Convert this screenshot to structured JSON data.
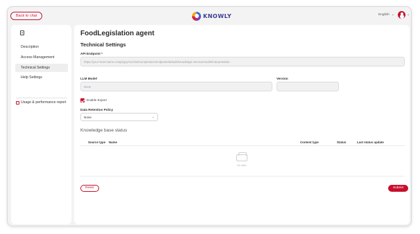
{
  "header": {
    "back_label": "Back to chat",
    "logo_text": "KNOWLY",
    "language": "English",
    "language_caret": "⌄",
    "avatar_caret": "⌄"
  },
  "sidebar": {
    "items": [
      {
        "label": "Description"
      },
      {
        "label": "Access Management"
      },
      {
        "label": "Technical Settings"
      },
      {
        "label": "Help Settings"
      }
    ],
    "report_label": "Usage & performance report"
  },
  "main": {
    "agent_name": "FoodLegislation agent",
    "section_title": "Technical Settings",
    "api_endpoint": {
      "label": "API Endpoint *",
      "placeholder": "https://your-host-name.cz/api/gcp/v1/chat/completions/endpoint/default/knowledge-service/model/interpretation"
    },
    "llm_model": {
      "label": "LLM Model",
      "value": "None"
    },
    "version": {
      "label": "Version",
      "value": ""
    },
    "enable_export": {
      "label": "Enable Export",
      "checked": true
    },
    "data_retention": {
      "label": "Data Retention Policy",
      "value": "None",
      "caret": "⌄"
    },
    "kb_status_title": "Knowledge base status",
    "table": {
      "columns": [
        "Source type",
        "Name",
        "Content type",
        "Status",
        "Last status update"
      ],
      "empty_text": "No data"
    },
    "reset_label": "Reset",
    "submit_label": "Submit"
  },
  "colors": {
    "accent": "#c8102e",
    "background": "#f3f3f4",
    "panel": "#ffffff"
  }
}
